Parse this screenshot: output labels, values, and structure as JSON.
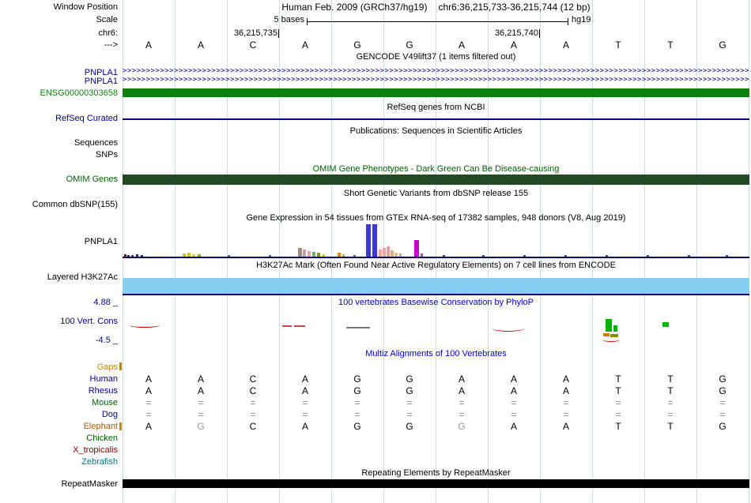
{
  "colors": {
    "label_blue": "#00008b",
    "title_blue": "#0000cc",
    "gene_green": "#0c820c",
    "omim_text_green": "#006400",
    "omim_bar_green": "#234a23",
    "h3k27ac_blue": "#87cff2",
    "navy": "#000080",
    "grid_blue": "#cadef2",
    "repeat_black": "#000000",
    "gaps_orange": "#c8860a"
  },
  "header": {
    "window_position_label": "Window Position",
    "assembly_title": "Human Feb. 2009 (GRCh37/hg19)",
    "position": "chr6:36,215,733-36,215,744 (12 bp)",
    "scale_label": "Scale",
    "scale_value": "5 bases",
    "assembly_short": "hg19",
    "chrom_label": "chr6:",
    "coord_left": "36,215,735",
    "coord_right": "36,215,740",
    "direction": "--->",
    "bases": [
      "A",
      "A",
      "C",
      "A",
      "G",
      "G",
      "A",
      "A",
      "A",
      "T",
      "T",
      "G"
    ]
  },
  "tracks": {
    "gencode": {
      "title": "GENCODE V49lift37 (1 items filtered out)",
      "items": [
        "PNPLA1",
        "PNPLA1"
      ],
      "ensg_label": "ENSG00000303658",
      "strand_char": ">",
      "strand_repeat": 175
    },
    "refseq": {
      "title": "RefSeq genes from NCBI",
      "label": "RefSeq Curated"
    },
    "publications": {
      "title": "Publications: Sequences in Scientific Articles",
      "label_sequences": "Sequences",
      "label_snps": "SNPs"
    },
    "omim": {
      "title": "OMIM Gene Phenotypes - Dark Green Can Be Disease-causing",
      "label": "OMIM Genes"
    },
    "dbsnp": {
      "title": "Short Genetic Variants from dbSNP release 155",
      "label": "Common dbSNP(155)"
    },
    "gtex": {
      "title": "Gene Expression in 54 tissues from GTEx RNA-seq of 17382 samples, 948 donors (V8, Aug 2019)",
      "label": "PNPLA1",
      "bars": [
        [
          157,
          3,
          3,
          "#7a1010"
        ],
        [
          161,
          3,
          2,
          "#333333"
        ],
        [
          166,
          3,
          2,
          "#444444"
        ],
        [
          172,
          3,
          3,
          "#223355"
        ],
        [
          178,
          3,
          2,
          "#333333"
        ],
        [
          231,
          4,
          4,
          "#d2c22a"
        ],
        [
          237,
          4,
          5,
          "#d2c22a"
        ],
        [
          243,
          4,
          3,
          "#ddd04a"
        ],
        [
          250,
          4,
          3,
          "#9aa02a"
        ],
        [
          288,
          3,
          2,
          "#666666"
        ],
        [
          340,
          3,
          2,
          "#666666"
        ],
        [
          377,
          5,
          11,
          "#9b8b80"
        ],
        [
          383,
          4,
          9,
          "#c79f9f"
        ],
        [
          389,
          4,
          7,
          "#e2a3b3"
        ],
        [
          395,
          4,
          6,
          "#6db36d"
        ],
        [
          401,
          4,
          5,
          "#8d8d35"
        ],
        [
          408,
          3,
          3,
          "#c9c94a"
        ],
        [
          427,
          4,
          5,
          "#e08a2a"
        ],
        [
          433,
          3,
          3,
          "#e0a050"
        ],
        [
          447,
          3,
          2,
          "#666666"
        ],
        [
          463,
          6,
          41,
          "#3939d3"
        ],
        [
          471,
          6,
          41,
          "#3939d3"
        ],
        [
          479,
          4,
          9,
          "#f0a3a3"
        ],
        [
          484,
          4,
          11,
          "#f0a3a3"
        ],
        [
          489,
          4,
          13,
          "#ec9a9a"
        ],
        [
          494,
          4,
          8,
          "#d8af8d"
        ],
        [
          499,
          4,
          5,
          "#e6b3a0"
        ],
        [
          505,
          3,
          4,
          "#bfae9e"
        ],
        [
          524,
          6,
          21,
          "#cc00cc"
        ],
        [
          532,
          3,
          4,
          "#a066a0"
        ],
        [
          560,
          3,
          2,
          "#555555"
        ],
        [
          610,
          3,
          2,
          "#555555"
        ],
        [
          662,
          3,
          2,
          "#555555"
        ],
        [
          714,
          3,
          2,
          "#555555"
        ],
        [
          766,
          3,
          2,
          "#555555"
        ],
        [
          818,
          3,
          2,
          "#555555"
        ],
        [
          870,
          3,
          2,
          "#555555"
        ],
        [
          918,
          3,
          2,
          "#555555"
        ]
      ]
    },
    "h3k27ac": {
      "title": "H3K27Ac Mark (Often Found Near Active Regulatory Elements) on 7 cell lines from ENCODE",
      "label": "Layered H3K27Ac"
    },
    "phylop": {
      "title": "100 vertebrates Basewise Conservation by PhyloP",
      "label": "100 Vert. Cons",
      "scale_max": "4.88 _",
      "scale_min": "-4.5 _",
      "marks": [
        [
          163,
          13,
          40,
          6,
          "#cc0000",
          "arc"
        ],
        [
          357,
          17,
          12,
          2,
          "#cc4444",
          "bar"
        ],
        [
          372,
          17,
          14,
          2,
          "#cc4444",
          "bar"
        ],
        [
          438,
          19,
          30,
          2,
          "#777777",
          "bar"
        ],
        [
          622,
          16,
          42,
          8,
          "#cc0000",
          "arc"
        ],
        [
          766,
          9,
          8,
          16,
          "#00b400",
          "bar"
        ],
        [
          776,
          17,
          5,
          8,
          "#00b400",
          "bar"
        ],
        [
          763,
          27,
          8,
          4,
          "#cc7700",
          "bar"
        ],
        [
          772,
          28,
          10,
          4,
          "#8a8a00",
          "bar"
        ],
        [
          762,
          33,
          22,
          4,
          "#cc0000",
          "arc"
        ],
        [
          838,
          13,
          8,
          6,
          "#00b400",
          "bar"
        ]
      ]
    },
    "multiz": {
      "title": "Multiz Alignments of 100 Vertebrates",
      "rows": [
        {
          "label": "Gaps",
          "color": "#c8860a",
          "letter_color": "#000000",
          "letters": [],
          "gray": []
        },
        {
          "label": "Human",
          "color": "#00008b",
          "letter_color": "#000000",
          "letters": [
            "A",
            "A",
            "C",
            "A",
            "G",
            "G",
            "A",
            "A",
            "A",
            "T",
            "T",
            "G"
          ],
          "gray": []
        },
        {
          "label": "Rhesus",
          "color": "#00008b",
          "letter_color": "#000000",
          "letters": [
            "A",
            "A",
            "C",
            "A",
            "G",
            "G",
            "A",
            "A",
            "A",
            "T",
            "T",
            "G"
          ],
          "gray": []
        },
        {
          "label": "Mouse",
          "color": "#006400",
          "letter_color": "#888888",
          "letters": [
            "=",
            "=",
            "=",
            "=",
            "=",
            "=",
            "=",
            "=",
            "=",
            "=",
            "=",
            "="
          ],
          "gray": []
        },
        {
          "label": "Dog",
          "color": "#00008b",
          "letter_color": "#888888",
          "letters": [
            "=",
            "=",
            "=",
            "=",
            "=",
            "=",
            "=",
            "=",
            "=",
            "=",
            "=",
            "="
          ],
          "gray": []
        },
        {
          "label": "Elephant",
          "color": "#a05a14",
          "letter_color": "#000000",
          "letters": [
            "A",
            "G",
            "C",
            "A",
            "G",
            "G",
            "G",
            "A",
            "A",
            "T",
            "T",
            "G"
          ],
          "gray": [
            1,
            6
          ]
        },
        {
          "label": "Chicken",
          "color": "#006400",
          "letter_color": "#000000",
          "letters": [],
          "gray": []
        },
        {
          "label": "X_tropicalis",
          "color": "#8b0000",
          "letter_color": "#000000",
          "letters": [],
          "gray": []
        },
        {
          "label": "Zebrafish",
          "color": "#007878",
          "letter_color": "#000000",
          "letters": [],
          "gray": []
        }
      ]
    },
    "repeatmasker": {
      "title": "Repeating Elements by RepeatMasker",
      "label": "RepeatMasker"
    }
  }
}
